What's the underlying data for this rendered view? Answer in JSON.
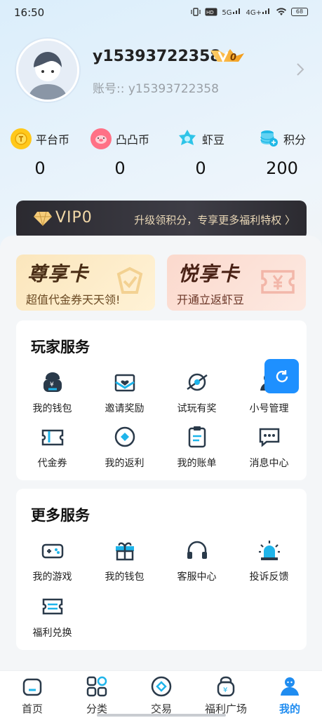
{
  "status_bar": {
    "time": "16:50",
    "icons": [
      "vibrate-icon",
      "hd-icon",
      "5g-signal-icon",
      "4g-signal-icon",
      "wifi-icon",
      "battery-icon"
    ],
    "network_1": "5G",
    "network_2": "4G+",
    "battery": "68"
  },
  "profile": {
    "username": "y15393722358",
    "vip_badge_level": "0",
    "account_label": "账号::",
    "account_value": "y15393722358"
  },
  "stats": [
    {
      "label": "平台币",
      "value": "0",
      "icon": "coin-icon",
      "color": "#f5b400"
    },
    {
      "label": "凸凸币",
      "value": "0",
      "icon": "pig-coin-icon",
      "color": "#ff6b7d"
    },
    {
      "label": "虾豆",
      "value": "0",
      "icon": "star-gem-icon",
      "color": "#2ec4e8"
    },
    {
      "label": "积分",
      "value": "200",
      "icon": "points-stack-icon",
      "color": "#1fb8e6"
    }
  ],
  "vip_banner": {
    "level": "VIP0",
    "promo": "升级领积分，专享更多福利特权 〉"
  },
  "cards": {
    "premium": {
      "title": "尊享卡",
      "subtitle": "超值代金券天天领!"
    },
    "joy": {
      "title": "悦享卡",
      "subtitle": "开通立返虾豆"
    }
  },
  "player_services": {
    "title": "玩家服务",
    "items": [
      {
        "label": "我的钱包",
        "icon": "wallet-icon"
      },
      {
        "label": "邀请奖励",
        "icon": "invite-envelope-icon"
      },
      {
        "label": "试玩有奖",
        "icon": "planet-icon"
      },
      {
        "label": "小号管理",
        "icon": "account-manage-icon"
      },
      {
        "label": "代金券",
        "icon": "voucher-icon"
      },
      {
        "label": "我的返利",
        "icon": "rebate-icon"
      },
      {
        "label": "我的账单",
        "icon": "bill-icon"
      },
      {
        "label": "消息中心",
        "icon": "message-icon"
      }
    ]
  },
  "more_services": {
    "title": "更多服务",
    "items": [
      {
        "label": "我的游戏",
        "icon": "gamepad-icon"
      },
      {
        "label": "我的钱包",
        "icon": "gift-icon"
      },
      {
        "label": "客服中心",
        "icon": "headset-icon"
      },
      {
        "label": "投诉反馈",
        "icon": "alarm-light-icon"
      },
      {
        "label": "福利兑换",
        "icon": "exchange-icon"
      }
    ]
  },
  "bottom_nav": [
    {
      "label": "首页",
      "icon": "home-icon",
      "active": false
    },
    {
      "label": "分类",
      "icon": "category-icon",
      "active": false
    },
    {
      "label": "交易",
      "icon": "trade-icon",
      "active": false
    },
    {
      "label": "福利广场",
      "icon": "welfare-bag-icon",
      "active": false
    },
    {
      "label": "我的",
      "icon": "profile-icon",
      "active": true
    }
  ],
  "colors": {
    "accent": "#1f8cf0",
    "icon_dark": "#2a3a4a",
    "icon_blue": "#1eb4ea"
  }
}
